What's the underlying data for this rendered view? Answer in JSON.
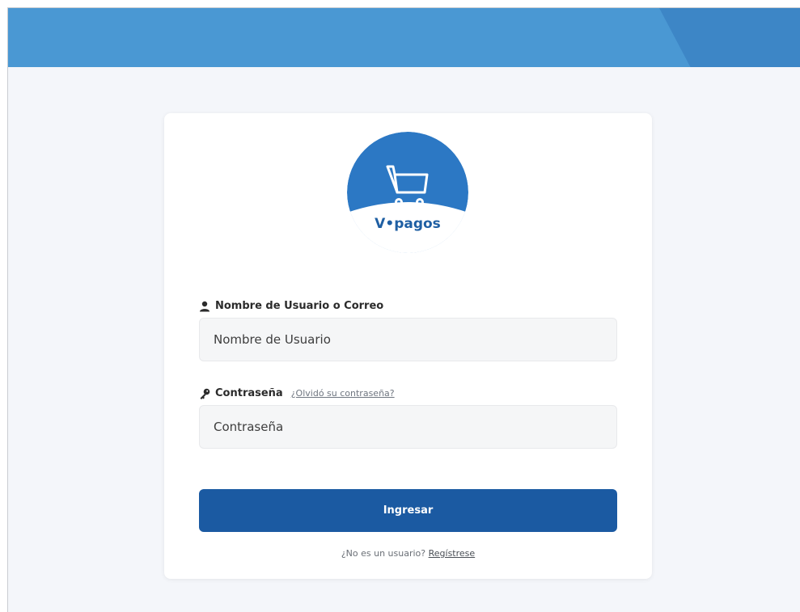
{
  "brand": {
    "logo_text": "V•pagos",
    "logo_icon": "shopping-cart-icon",
    "colors": {
      "top_bar": "#4a98d3",
      "top_bar_accent": "#3d86c6",
      "primary_button": "#1b5aa2",
      "logo_circle": "#2c78c4",
      "logo_text": "#1f5fa3"
    }
  },
  "form": {
    "username": {
      "label": "Nombre de Usuario o Correo",
      "icon": "user-icon",
      "placeholder": "Nombre de Usuario",
      "value": ""
    },
    "password": {
      "label": "Contraseña",
      "icon": "key-icon",
      "forgot_link": "¿Olvidó su contraseña?",
      "placeholder": "Contraseña",
      "value": ""
    },
    "submit_label": "Ingresar",
    "register_prompt": "¿No es un usuario?",
    "register_link": "Regístrese"
  }
}
